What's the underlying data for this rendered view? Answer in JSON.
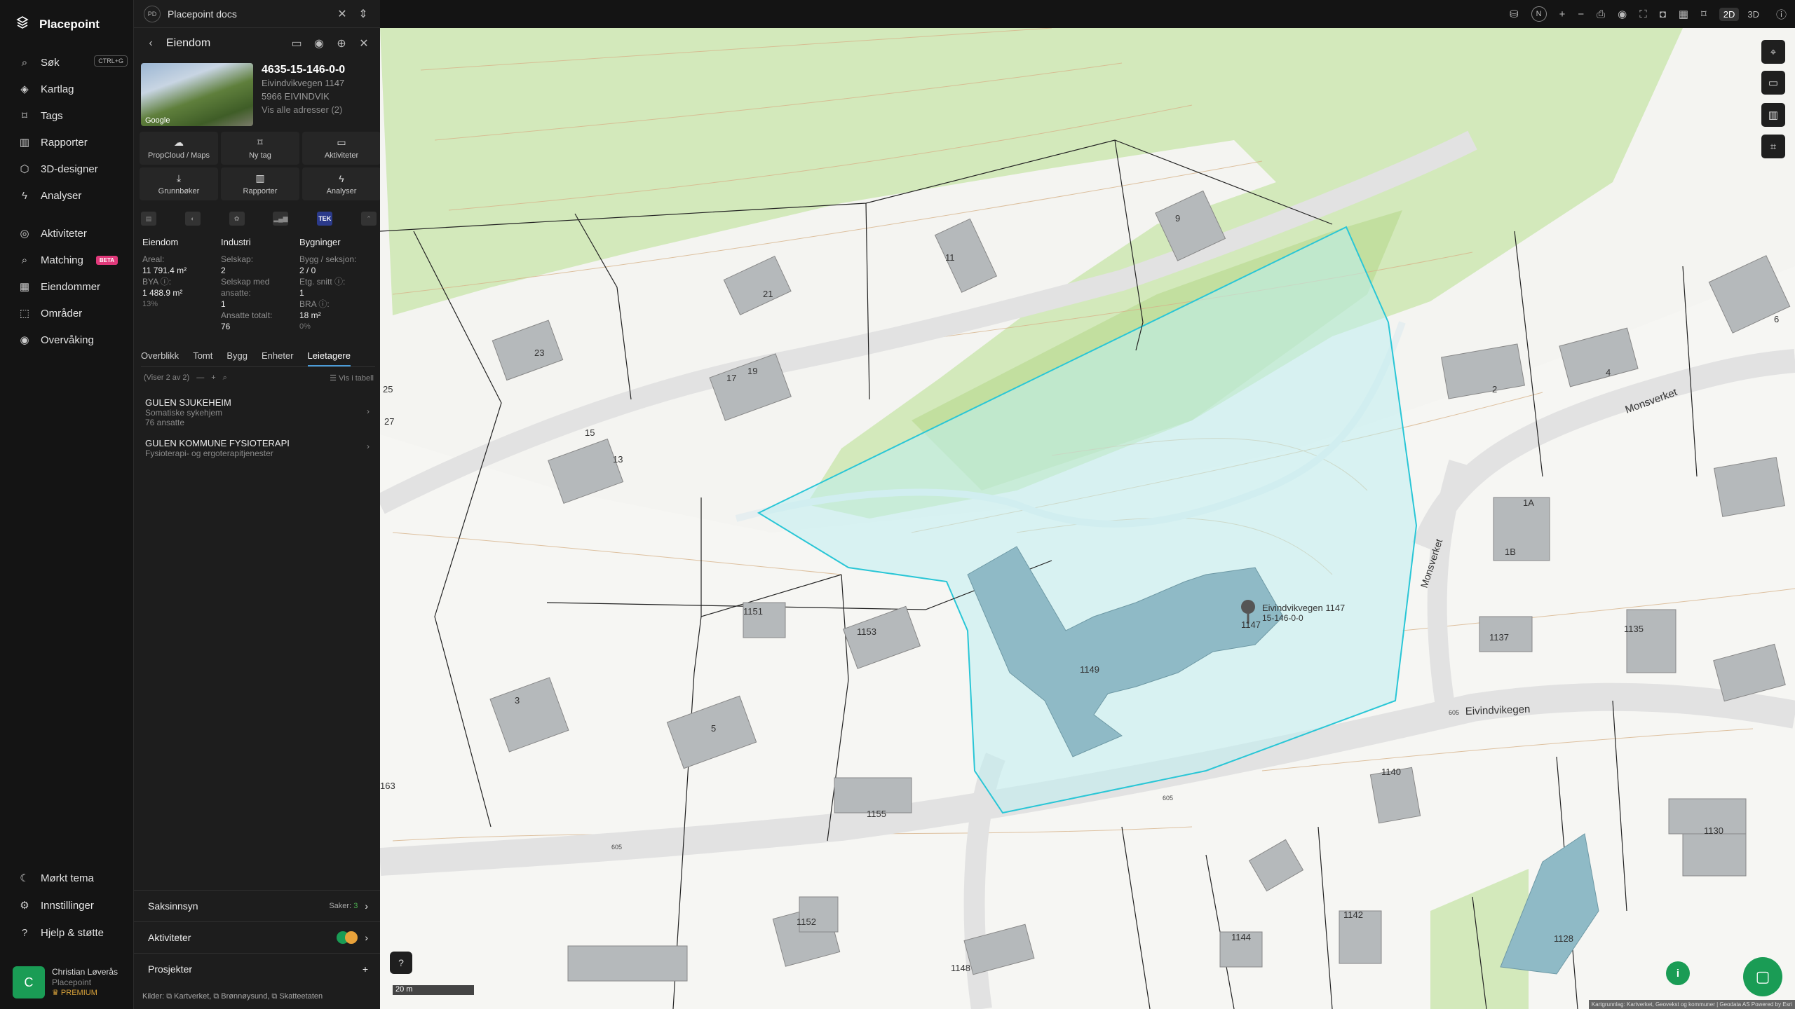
{
  "app": {
    "name": "Placepoint"
  },
  "nav": {
    "items": [
      {
        "label": "Søk",
        "icon": "search-icon",
        "shortcut": "CTRL+G"
      },
      {
        "label": "Kartlag",
        "icon": "layers-icon"
      },
      {
        "label": "Tags",
        "icon": "bookmark-icon"
      },
      {
        "label": "Rapporter",
        "icon": "chart-icon"
      },
      {
        "label": "3D-designer",
        "icon": "cube-icon"
      },
      {
        "label": "Analyser",
        "icon": "bolt-icon"
      },
      {
        "label": "Aktiviteter",
        "icon": "activity-icon"
      },
      {
        "label": "Matching",
        "icon": "search-icon",
        "badge": "BETA"
      },
      {
        "label": "Eiendommer",
        "icon": "building-icon"
      },
      {
        "label": "Områder",
        "icon": "area-icon"
      },
      {
        "label": "Overvåking",
        "icon": "monitor-icon"
      }
    ],
    "bottom": [
      {
        "label": "Mørkt tema",
        "icon": "moon-icon"
      },
      {
        "label": "Innstillinger",
        "icon": "gear-icon"
      },
      {
        "label": "Hjelp & støtte",
        "icon": "help-icon"
      }
    ],
    "user": {
      "initial": "C",
      "name": "Christian Løverås",
      "org": "Placepoint",
      "plan": "PREMIUM"
    }
  },
  "panel": {
    "tab": {
      "badge": "PD",
      "title": "Placepoint docs"
    },
    "header": {
      "title": "Eiendom"
    },
    "property": {
      "id": "4635-15-146-0-0",
      "address": "Eivindvikvegen 1147",
      "postal": "5966 EIVINDVIK",
      "all_addresses": "Vis alle adresser (2)",
      "thumb_label": "Google"
    },
    "actions": [
      {
        "label": "PropCloud / Maps",
        "icon": "cloud-icon"
      },
      {
        "label": "Ny tag",
        "icon": "bookmark-icon"
      },
      {
        "label": "Aktiviteter",
        "icon": "chat-icon"
      },
      {
        "label": "Grunnbøker",
        "icon": "download-icon"
      },
      {
        "label": "Rapporter",
        "icon": "chart-icon"
      },
      {
        "label": "Analyser",
        "icon": "bolt-icon"
      }
    ],
    "source_tek": "TEK",
    "stats": {
      "eiendom": {
        "title": "Eiendom",
        "areal_label": "Areal:",
        "areal_value": "11 791.4 m²",
        "bya_label": "BYA ⓘ:",
        "bya_value": "1 488.9 m²",
        "bya_pct": "13%"
      },
      "industri": {
        "title": "Industri",
        "selskap_label": "Selskap:",
        "selskap_value": "2",
        "ansatte_label": "Selskap med ansatte:",
        "ansatte_value": "1",
        "totalt_label": "Ansatte totalt:",
        "totalt_value": "76"
      },
      "bygninger": {
        "title": "Bygninger",
        "bygg_label": "Bygg / seksjon:",
        "bygg_value": "2 / 0",
        "etg_label": "Etg. snitt ⓘ:",
        "etg_value": "1",
        "bra_label": "BRA ⓘ:",
        "bra_value": "18 m²",
        "bra_pct": "0%"
      }
    },
    "subtabs": [
      "Overblikk",
      "Tomt",
      "Bygg",
      "Enheter",
      "Leietagere"
    ],
    "active_subtab": "Leietagere",
    "list_info": "(Viser 2 av 2)",
    "list_table_link": "Vis i tabell",
    "tenants": [
      {
        "name": "GULEN SJUKEHEIM",
        "desc": "Somatiske sykehjem",
        "extra": "76 ansatte"
      },
      {
        "name": "GULEN KOMMUNE FYSIOTERAPI",
        "desc": "Fysioterapi- og ergoterapitjenester",
        "extra": ""
      }
    ],
    "sections": [
      {
        "label": "Saksinnsyn",
        "meta_label": "Saker:",
        "meta_value": "3"
      },
      {
        "label": "Aktiviteter"
      },
      {
        "label": "Prosjekter"
      }
    ],
    "footer": "Kilder: ⧉ Kartverket, ⧉ Brønnøysund, ⧉ Skatteetaten"
  },
  "topbar": {
    "north": "N",
    "mode_2d": "2D",
    "mode_3d": "3D"
  },
  "map": {
    "marker_label_1": "Eivindvikvegen 1147",
    "marker_label_2": "15-146-0-0",
    "road_1": "Eivindvikegen",
    "road_2": "Monsverket",
    "road_3": "Monsverket",
    "house_numbers": [
      "1147",
      "1149",
      "1151",
      "1153",
      "1155",
      "1140",
      "1137",
      "1135",
      "1130",
      "1128",
      "1144",
      "1142",
      "1148",
      "1152",
      "11",
      "21",
      "23",
      "25",
      "27",
      "17",
      "19",
      "15",
      "13",
      "9",
      "3",
      "5",
      "2",
      "4",
      "1A",
      "1B",
      "6",
      "163"
    ],
    "road_refs": [
      "605",
      "605",
      "605"
    ],
    "scale": "20 m",
    "attribution": "Kartgrunnlag: Kartverket, Geovekst og kommuner | Geodata AS Powered by Esri",
    "colors": {
      "parcel": "#29c6d6",
      "forest": "#cfe8b6",
      "building": "#8fbac6",
      "road": "#e2e2e2"
    }
  }
}
